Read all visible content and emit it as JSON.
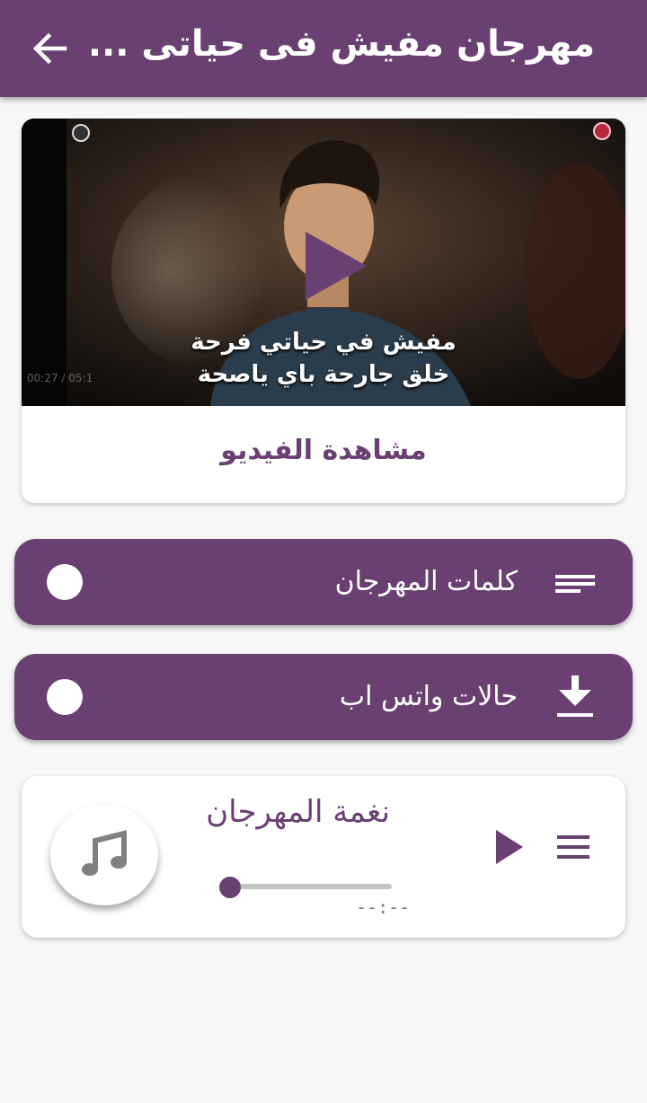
{
  "app_bar": {
    "title": "مهرجان مفيش فى حياتى ...",
    "back_icon": "arrow-left-icon"
  },
  "video": {
    "caption_line1": "مفيش في حياتي فرحة",
    "caption_line2": "خلق جارحة باي ياصحة",
    "time_overlay": "00:27 / 05:1",
    "watch_label": "مشاهدة الفيديو",
    "play_icon": "play-icon"
  },
  "menu": [
    {
      "label": "كلمات المهرجان",
      "icon": "lyrics-lines-icon"
    },
    {
      "label": "حالات واتس اب",
      "icon": "download-icon"
    }
  ],
  "player": {
    "title": "نغمة المهرجان",
    "duration": "--:--",
    "progress": 0,
    "disc_icon": "music-note-icon",
    "play_icon": "play-icon",
    "menu_icon": "hamburger-menu-icon"
  },
  "colors": {
    "primary": "#6a4073",
    "background": "#f7f7f7",
    "surface": "#ffffff"
  }
}
